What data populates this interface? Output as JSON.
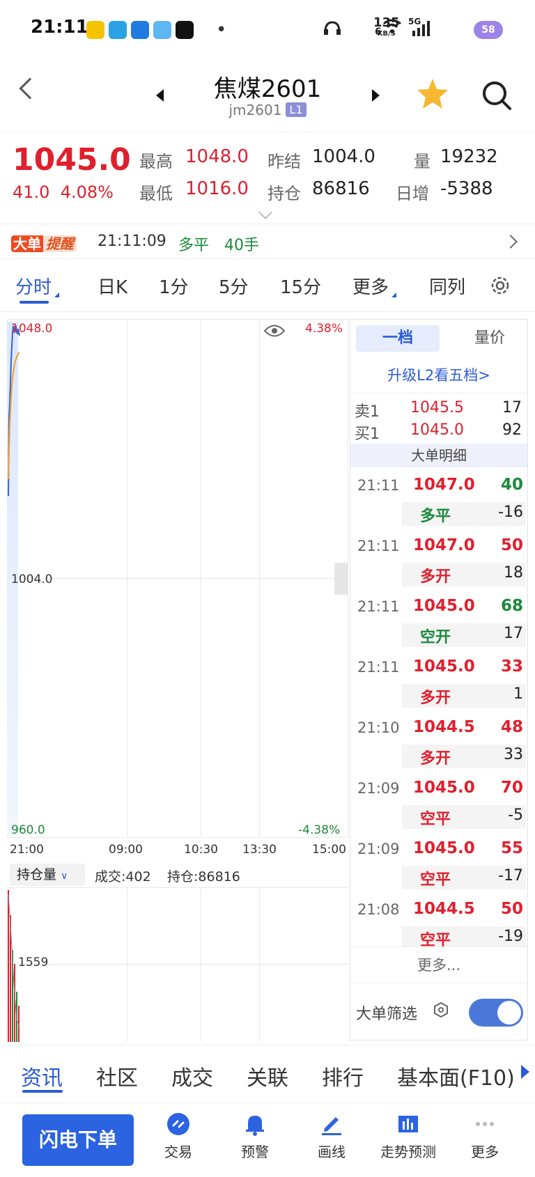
{
  "status_bar": {
    "time": "21:11",
    "net_speed_value": "135",
    "net_speed_unit": "KB/S",
    "signal_extra": "6",
    "network": "5G",
    "battery": "58"
  },
  "header": {
    "title": "焦煤2601",
    "code": "jm2601",
    "level_badge": "L1"
  },
  "quote": {
    "price": "1045.0",
    "change": "41.0",
    "change_pct": "4.08%",
    "high_label": "最高",
    "high": "1048.0",
    "low_label": "最低",
    "low": "1016.0",
    "prev_settle_label": "昨结",
    "prev_settle": "1004.0",
    "open_int_label": "持仓",
    "open_int": "86816",
    "volume_label": "量",
    "volume": "19232",
    "daily_incr_label": "日增",
    "daily_incr": "-5388"
  },
  "alert": {
    "badge_a": "大单",
    "badge_b": "提醒",
    "time": "21:11:09",
    "type": "多平",
    "qty": "40手"
  },
  "period_tabs": [
    "分时",
    "日K",
    "1分",
    "5分",
    "15分",
    "更多",
    "同列"
  ],
  "chart": {
    "y_top": "1048.0",
    "y_mid": "1004.0",
    "y_bottom": "960.0",
    "pct_top": "4.38%",
    "pct_bottom": "-4.38%",
    "x_labels": [
      "21:00",
      "09:00",
      "10:30",
      "13:30",
      "15:00"
    ],
    "sub_select": "持仓量",
    "sub_volume": "成交:402",
    "sub_openint": "持仓:86816",
    "sub_y_label": "1559",
    "colors": {
      "price_line": "#3a62c8",
      "avg_line": "#f0a030"
    }
  },
  "book": {
    "tab_active": "一档",
    "tab_inactive": "量价",
    "upgrade": "升级L2看五档>",
    "sell1_label": "卖1",
    "sell1_price": "1045.5",
    "sell1_qty": "17",
    "buy1_label": "买1",
    "buy1_price": "1045.0",
    "buy1_qty": "92",
    "detail_head": "大单明细",
    "trades": [
      {
        "time": "21:11",
        "price": "1047.0",
        "vol": "40",
        "kind": "多平",
        "delta": "-16",
        "vol_color": "green",
        "kind_color": "green"
      },
      {
        "time": "21:11",
        "price": "1047.0",
        "vol": "50",
        "kind": "多开",
        "delta": "18",
        "vol_color": "red",
        "kind_color": "red"
      },
      {
        "time": "21:11",
        "price": "1045.0",
        "vol": "68",
        "kind": "空开",
        "delta": "17",
        "vol_color": "green",
        "kind_color": "green"
      },
      {
        "time": "21:11",
        "price": "1045.0",
        "vol": "33",
        "kind": "多开",
        "delta": "1",
        "vol_color": "red",
        "kind_color": "red"
      },
      {
        "time": "21:10",
        "price": "1044.5",
        "vol": "48",
        "kind": "多开",
        "delta": "33",
        "vol_color": "red",
        "kind_color": "red"
      },
      {
        "time": "21:09",
        "price": "1045.0",
        "vol": "70",
        "kind": "空平",
        "delta": "-5",
        "vol_color": "red",
        "kind_color": "red"
      },
      {
        "time": "21:09",
        "price": "1045.0",
        "vol": "55",
        "kind": "空平",
        "delta": "-17",
        "vol_color": "red",
        "kind_color": "red"
      },
      {
        "time": "21:08",
        "price": "1044.5",
        "vol": "50",
        "kind": "空平",
        "delta": "-19",
        "vol_color": "red",
        "kind_color": "red"
      }
    ],
    "more": "更多...",
    "filter_label": "大单筛选"
  },
  "info_tabs": [
    "资讯",
    "社区",
    "成交",
    "关联",
    "排行",
    "基本面(F10)"
  ],
  "bottom_nav": {
    "flash_order": "闪电下单",
    "items": [
      "交易",
      "预警",
      "画线",
      "走势预测",
      "更多"
    ]
  }
}
